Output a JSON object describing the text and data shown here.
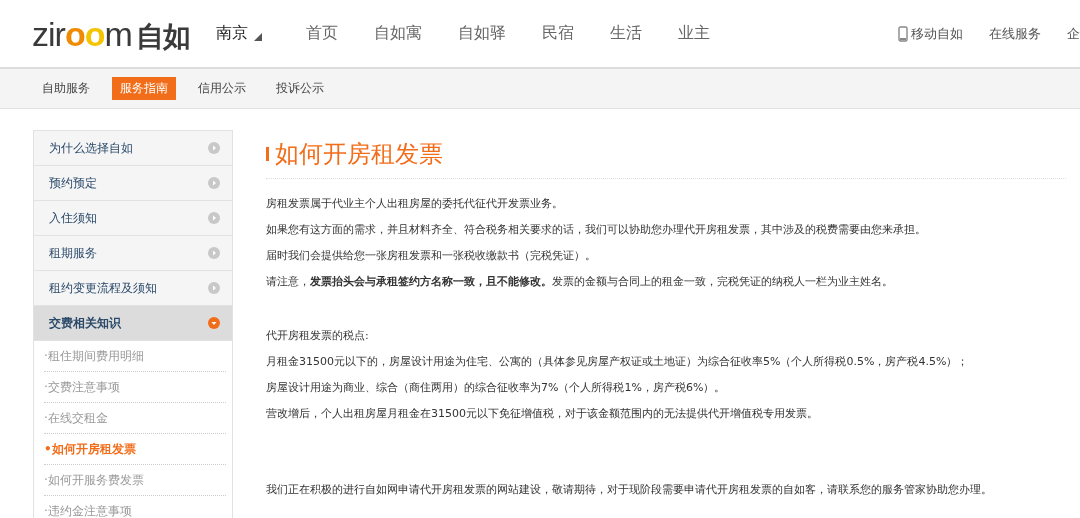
{
  "header": {
    "logo": {
      "text_parts": [
        {
          "text": "zi",
          "kind": "plain"
        },
        {
          "text": "r",
          "kind": "plain"
        },
        {
          "text": "o",
          "kind": "ring1"
        },
        {
          "text": "o",
          "kind": "ring2"
        },
        {
          "text": "m",
          "kind": "plain"
        }
      ],
      "cn": "自如"
    },
    "city": "南京",
    "nav": [
      "首页",
      "自如寓",
      "自如驿",
      "民宿",
      "生活",
      "业主"
    ],
    "right_links": [
      {
        "label": "移动自如",
        "kind": "mobile"
      },
      {
        "label": "在线服务",
        "kind": "plain"
      },
      {
        "label": "企",
        "kind": "plain"
      }
    ]
  },
  "subnav": [
    {
      "label": "自助服务",
      "selected": false
    },
    {
      "label": "服务指南",
      "selected": true
    },
    {
      "label": "信用公示",
      "selected": false
    },
    {
      "label": "投诉公示",
      "selected": false
    }
  ],
  "sidebar": [
    {
      "label": "为什么选择自如",
      "expanded": false
    },
    {
      "label": "预约预定",
      "expanded": false
    },
    {
      "label": "入住须知",
      "expanded": false
    },
    {
      "label": "租期服务",
      "expanded": false
    },
    {
      "label": "租约变更流程及须知",
      "expanded": false
    },
    {
      "label": "交费相关知识",
      "expanded": true,
      "children": [
        {
          "label": "·租住期间费用明细",
          "selected": false
        },
        {
          "label": "·交费注意事项",
          "selected": false
        },
        {
          "label": "·在线交租金",
          "selected": false
        },
        {
          "label": "•如何开房租发票",
          "selected": true
        },
        {
          "label": "·如何开服务费发票",
          "selected": false
        },
        {
          "label": "·违约金注意事项",
          "selected": false
        }
      ]
    }
  ],
  "article": {
    "title": "如何开房租发票",
    "sections": [
      [
        "房租发票属于代业主个人出租房屋的委托代征代开发票业务。",
        "如果您有这方面的需求，并且材料齐全、符合税务相关要求的话，我们可以协助您办理代开房租发票，其中涉及的税费需要由您来承担。",
        "届时我们会提供给您一张房租发票和一张税收缴款书（完税凭证）。",
        "请注意，**发票抬头会与承租签约方名称一致，且不能修改。**发票的金额与合同上的租金一致，完税凭证的纳税人一栏为业主姓名。"
      ],
      [
        "代开房租发票的税点:",
        "月租金31500元以下的，房屋设计用途为住宅、公寓的（具体参见房屋产权证或土地证）为综合征收率5%（个人所得税0.5%，房产税4.5%）；",
        "房屋设计用途为商业、综合（商住两用）的综合征收率为7%（个人所得税1%，房产税6%）。",
        "营改增后，个人出租房屋月租金在31500元以下免征增值税，对于该金额范围内的无法提供代开增值税专用发票。"
      ],
      [
        "我们正在积极的进行自如网申请代开房租发票的网站建设，敬请期待，对于现阶段需要申请代开房租发票的自如客，请联系您的服务管家协助您办理。"
      ]
    ]
  }
}
